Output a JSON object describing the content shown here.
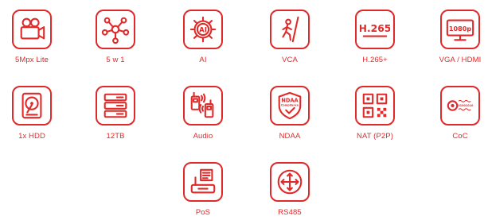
{
  "accent_color": "#e02a2a",
  "features": [
    {
      "icon": "video-camera-icon",
      "label": "5Mpx Lite"
    },
    {
      "icon": "network-hub-icon",
      "label": "5 w 1"
    },
    {
      "icon": "ai-chip-icon",
      "label": "AI"
    },
    {
      "icon": "line-crossing-person-icon",
      "label": "VCA"
    },
    {
      "icon": "h265-codec-icon",
      "label": "H.265+",
      "icon_text": "H.265"
    },
    {
      "icon": "monitor-1080p-icon",
      "label": "VGA / HDMI",
      "icon_text": "1080p"
    },
    {
      "icon": "hard-disk-icon",
      "label": "1x HDD"
    },
    {
      "icon": "storage-server-icon",
      "label": "12TB"
    },
    {
      "icon": "audio-walkie-talkie-icon",
      "label": "Audio"
    },
    {
      "icon": "ndaa-shield-icon",
      "label": "NDAA",
      "icon_text": "NDAA",
      "icon_subtext": "Compliance"
    },
    {
      "icon": "qr-code-icon",
      "label": "NAT (P2P)"
    },
    {
      "icon": "coc-signal-icon",
      "label": "CoC",
      "icon_text": "101001010"
    },
    {
      "icon": "pos-terminal-icon",
      "label": "PoS"
    },
    {
      "icon": "rs485-arrows-icon",
      "label": "RS485"
    }
  ]
}
